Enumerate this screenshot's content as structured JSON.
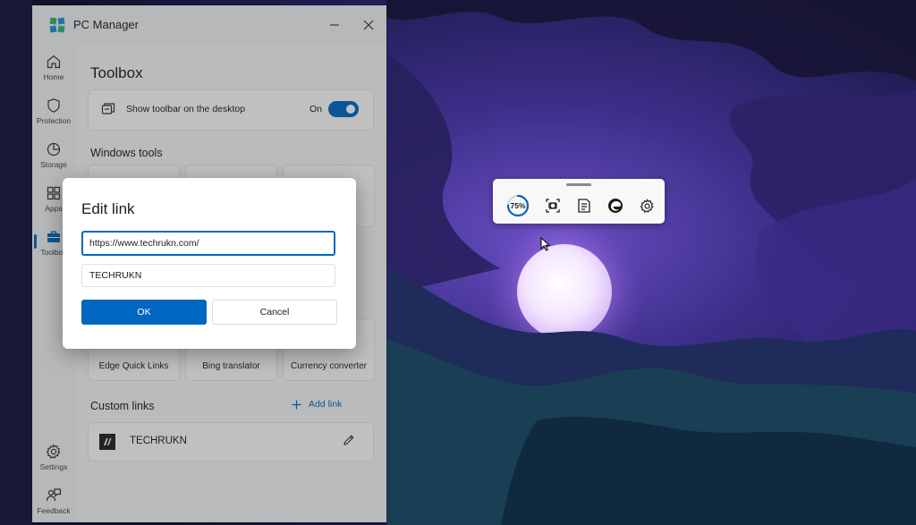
{
  "window": {
    "title": "PC Manager",
    "page_title": "Toolbox"
  },
  "nav": {
    "items": [
      {
        "label": "Home",
        "icon": "home-icon"
      },
      {
        "label": "Protection",
        "icon": "shield-icon"
      },
      {
        "label": "Storage",
        "icon": "storage-icon"
      },
      {
        "label": "Apps",
        "icon": "apps-icon"
      },
      {
        "label": "Toolbox",
        "icon": "toolbox-icon",
        "active": true
      }
    ],
    "bottom_items": [
      {
        "label": "Settings",
        "icon": "gear-icon"
      },
      {
        "label": "Feedback",
        "icon": "feedback-icon"
      }
    ]
  },
  "toolbar_setting": {
    "label": "Show toolbar on the desktop",
    "state_label": "On",
    "enabled": true
  },
  "windows_tools": {
    "section_title": "Windows tools",
    "bottom_row": [
      "Edge Quick Links",
      "Bing translator",
      "Currency converter"
    ]
  },
  "custom_links": {
    "section_title": "Custom links",
    "add_label": "Add link",
    "items": [
      {
        "name": "TECHRUKN"
      }
    ]
  },
  "dialog": {
    "title": "Edit link",
    "url_value": "https://www.techrukn.com/",
    "name_value": "TECHRUKN",
    "ok_label": "OK",
    "cancel_label": "Cancel"
  },
  "floating_toolbar": {
    "memory_gauge": {
      "label": "75%",
      "value": 0.75
    },
    "tools": [
      "screenshot-icon",
      "notes-icon",
      "edge-icon",
      "gear-icon"
    ]
  },
  "colors": {
    "accent": "#0067c0",
    "window_bg": "#eef0f3",
    "card_bg": "#fbfbfc"
  }
}
